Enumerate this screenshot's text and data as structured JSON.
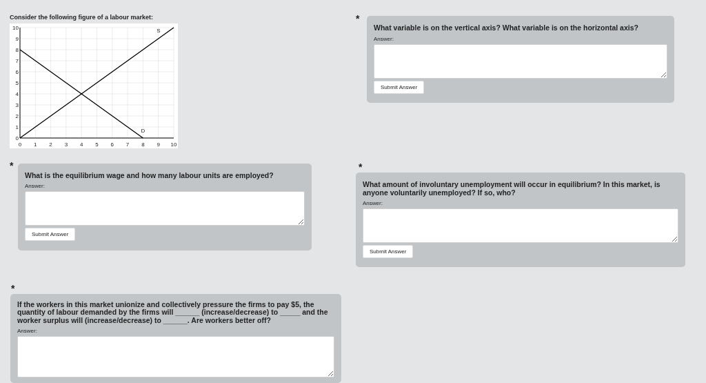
{
  "left_column": {
    "intro": "Consider the following figure of a labour market:",
    "chart_data": {
      "type": "line",
      "grid": true,
      "x": [
        0,
        1,
        2,
        3,
        4,
        5,
        6,
        7,
        8,
        9,
        10
      ],
      "xlim": [
        0,
        10
      ],
      "ylim": [
        0,
        10
      ],
      "xticks": [
        0,
        1,
        2,
        3,
        4,
        5,
        6,
        7,
        8,
        9,
        10
      ],
      "yticks": [
        0,
        1,
        2,
        3,
        4,
        5,
        6,
        7,
        8,
        9,
        10
      ],
      "series": [
        {
          "name": "S",
          "color": "#000000",
          "values": [
            0,
            1,
            2,
            3,
            4,
            5,
            6,
            7,
            8,
            9,
            10
          ]
        },
        {
          "name": "D",
          "color": "#000000",
          "values": [
            8,
            7,
            6,
            5,
            4,
            3,
            2,
            1,
            0,
            null,
            null
          ]
        }
      ]
    },
    "questions": [
      {
        "marker": "*",
        "prompt": "What is the equilibrium wage and how many labour units are employed?",
        "answer_label": "Answer:",
        "button": "Submit Answer"
      },
      {
        "marker": "*",
        "prompt": "If the workers in this market unionize and collectively pressure the firms to pay $5, the quantity of labour demanded by the firms will ______ (increase/decrease) to _____ and the worker surplus will (increase/decrease) to ______. Are workers better off?",
        "answer_label": "Answer:"
      }
    ]
  },
  "right_column": {
    "questions": [
      {
        "marker": "*",
        "prompt": "What variable is on the vertical axis? What variable is on the horizontal axis?",
        "answer_label": "Answer:",
        "button": "Submit Answer"
      },
      {
        "marker": "*",
        "prompt": "What amount of involuntary unemployment will occur in equilibrium? In this market, is anyone voluntarily unemployed? If so, who?",
        "answer_label": "Answer:",
        "button": "Submit Answer"
      }
    ]
  }
}
